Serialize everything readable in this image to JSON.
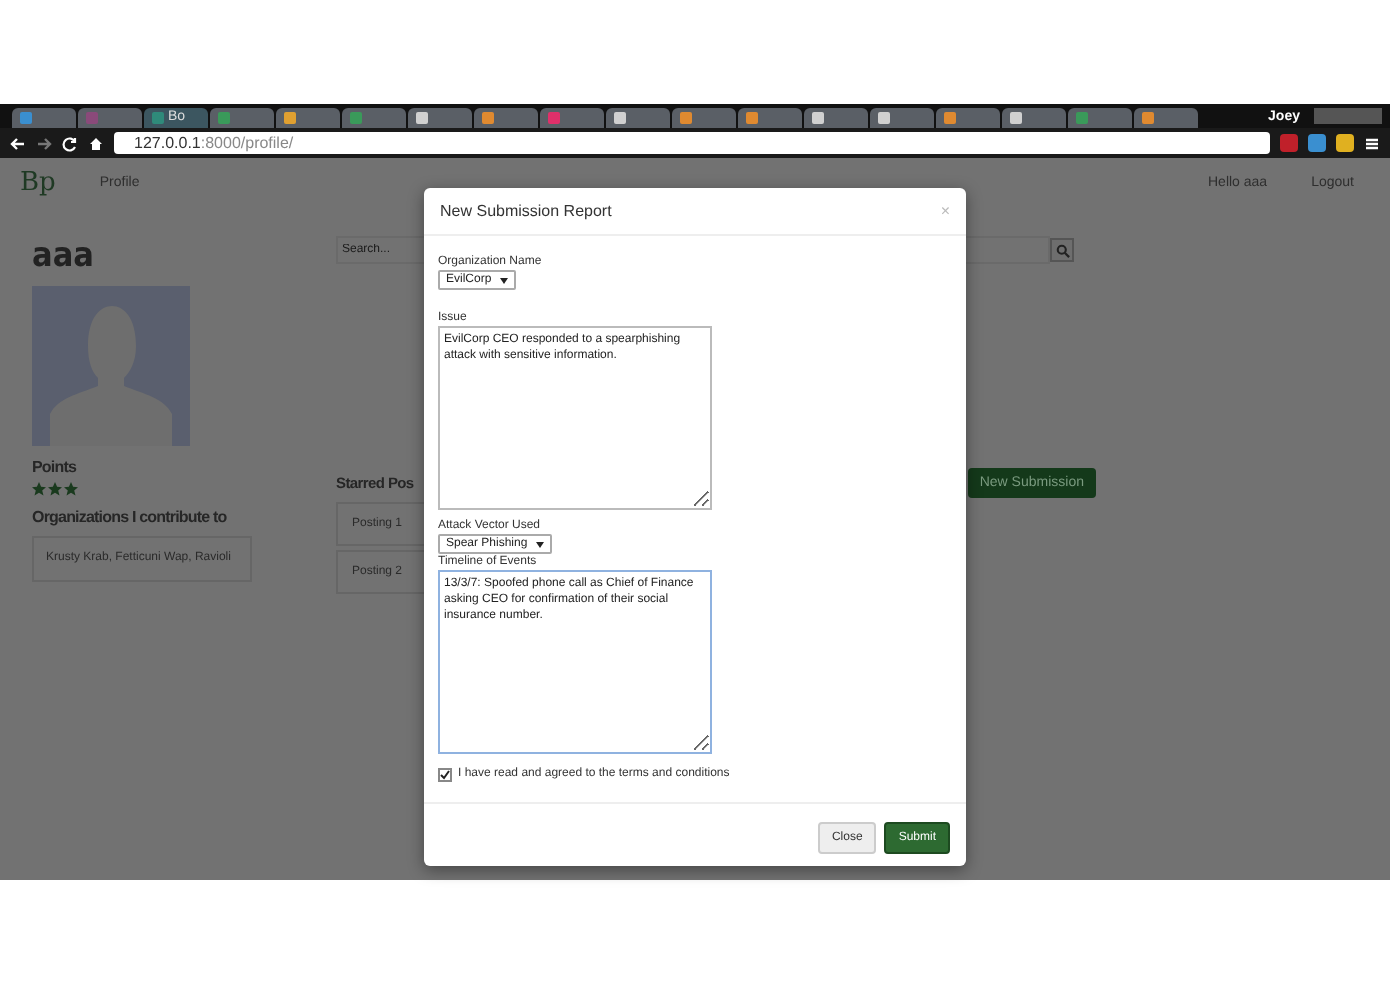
{
  "browser": {
    "tabs": [
      {
        "selected": false,
        "color": "#3a8fd0"
      },
      {
        "selected": false,
        "color": "#8a4a7a"
      },
      {
        "selected": true,
        "color": "#2f8a7a",
        "title": "Bo"
      },
      {
        "selected": false,
        "color": "#3a9a5a"
      },
      {
        "selected": false,
        "color": "#e0a030"
      },
      {
        "selected": false,
        "color": "#3a9a5a"
      },
      {
        "selected": false,
        "color": "#d0d0d0"
      },
      {
        "selected": false,
        "color": "#e08a30"
      },
      {
        "selected": false,
        "color": "#e0306a"
      },
      {
        "selected": false,
        "color": "#d0d0d0"
      },
      {
        "selected": false,
        "color": "#e08a30"
      },
      {
        "selected": false,
        "color": "#e08a30"
      },
      {
        "selected": false,
        "color": "#d0d0d0"
      },
      {
        "selected": false,
        "color": "#d0d0d0"
      },
      {
        "selected": false,
        "color": "#e08a30"
      },
      {
        "selected": false,
        "color": "#d0d0d0"
      },
      {
        "selected": false,
        "color": "#3a9a5a"
      },
      {
        "selected": false,
        "color": "#e08a30"
      }
    ],
    "profile": "Joey",
    "url_host": "127.0.0.1",
    "url_rest": ":8000/profile/"
  },
  "nav": {
    "logo": "Bp",
    "link": "Profile",
    "greeting": "Hello aaa",
    "logout": "Logout"
  },
  "profile": {
    "name": "aaa",
    "points_label": "Points",
    "stars": 3,
    "orgs_heading": "Organizations I contribute to",
    "orgs": "Krusty Krab, Fetticuni Wap, Ravioli"
  },
  "search": {
    "placeholder": "Search..."
  },
  "starred": {
    "heading": "Starred Pos",
    "postings": [
      "Posting 1",
      "Posting 2"
    ]
  },
  "new_submission": "New Submission",
  "modal": {
    "title": "New Submission Report",
    "close_x": "×",
    "org_label": "Organization Name",
    "org_value": "EvilCorp",
    "issue_label": "Issue",
    "issue_value": "EvilCorp CEO responded to a spearphishing attack with sensitive information.",
    "vector_label": "Attack Vector Used",
    "vector_value": "Spear Phishing",
    "timeline_label": "Timeline of Events",
    "timeline_value": "13/3/7: Spoofed phone call as Chief of Finance asking CEO for confirmation of their social insurance number.",
    "terms": {
      "label": "I have read and agreed to the terms and conditions",
      "checked": true
    },
    "buttons": {
      "close": "Close",
      "submit": "Submit"
    }
  }
}
